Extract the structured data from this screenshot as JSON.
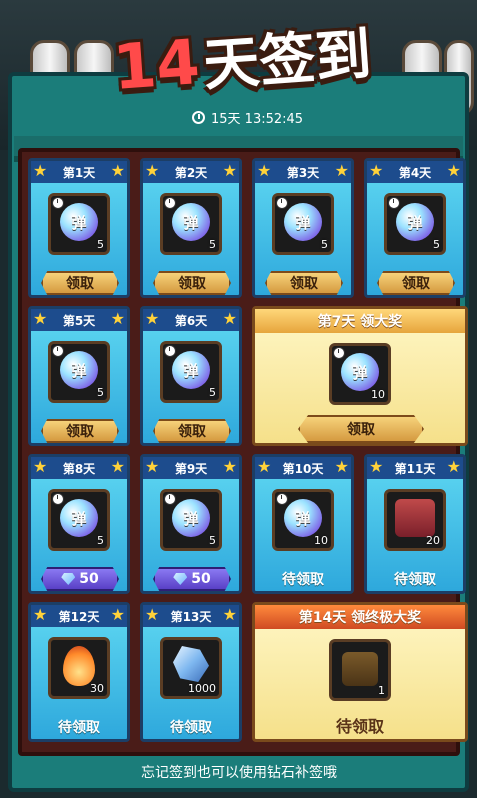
{
  "header": {
    "title_number": "14",
    "title_text": "天签到",
    "timer": "15天 13:52:45"
  },
  "days": [
    {
      "label": "第1天",
      "item": "弹",
      "qty": "5",
      "button": "领取",
      "state": "claim"
    },
    {
      "label": "第2天",
      "item": "弹",
      "qty": "5",
      "button": "领取",
      "state": "claim"
    },
    {
      "label": "第3天",
      "item": "弹",
      "qty": "5",
      "button": "领取",
      "state": "claim"
    },
    {
      "label": "第4天",
      "item": "弹",
      "qty": "5",
      "button": "领取",
      "state": "claim"
    },
    {
      "label": "第5天",
      "item": "弹",
      "qty": "5",
      "button": "领取",
      "state": "claim"
    },
    {
      "label": "第6天",
      "item": "弹",
      "qty": "5",
      "button": "领取",
      "state": "claim"
    },
    {
      "label": "第7天 领大奖",
      "item": "弹",
      "qty": "10",
      "button": "领取",
      "state": "claim"
    },
    {
      "label": "第8天",
      "item": "弹",
      "qty": "5",
      "button": "50",
      "state": "diamond"
    },
    {
      "label": "第9天",
      "item": "弹",
      "qty": "5",
      "button": "50",
      "state": "diamond"
    },
    {
      "label": "第10天",
      "item": "弹",
      "qty": "10",
      "button": "待领取",
      "state": "pending"
    },
    {
      "label": "第11天",
      "item": "",
      "qty": "20",
      "button": "待领取",
      "state": "pending"
    },
    {
      "label": "第12天",
      "item": "",
      "qty": "30",
      "button": "待领取",
      "state": "pending"
    },
    {
      "label": "第13天",
      "item": "",
      "qty": "1000",
      "button": "待领取",
      "state": "pending"
    },
    {
      "label": "第14天 领终极大奖",
      "item": "",
      "qty": "1",
      "button": "待领取",
      "state": "pending"
    }
  ],
  "footer": {
    "text": "忘记签到也可以使用钻石补签哦"
  },
  "colors": {
    "panel": "#1b7d7a",
    "board": "#4a1c18",
    "card": "#2ea8dc",
    "claim_button": "#d59a40",
    "diamond_button": "#5940c6"
  }
}
